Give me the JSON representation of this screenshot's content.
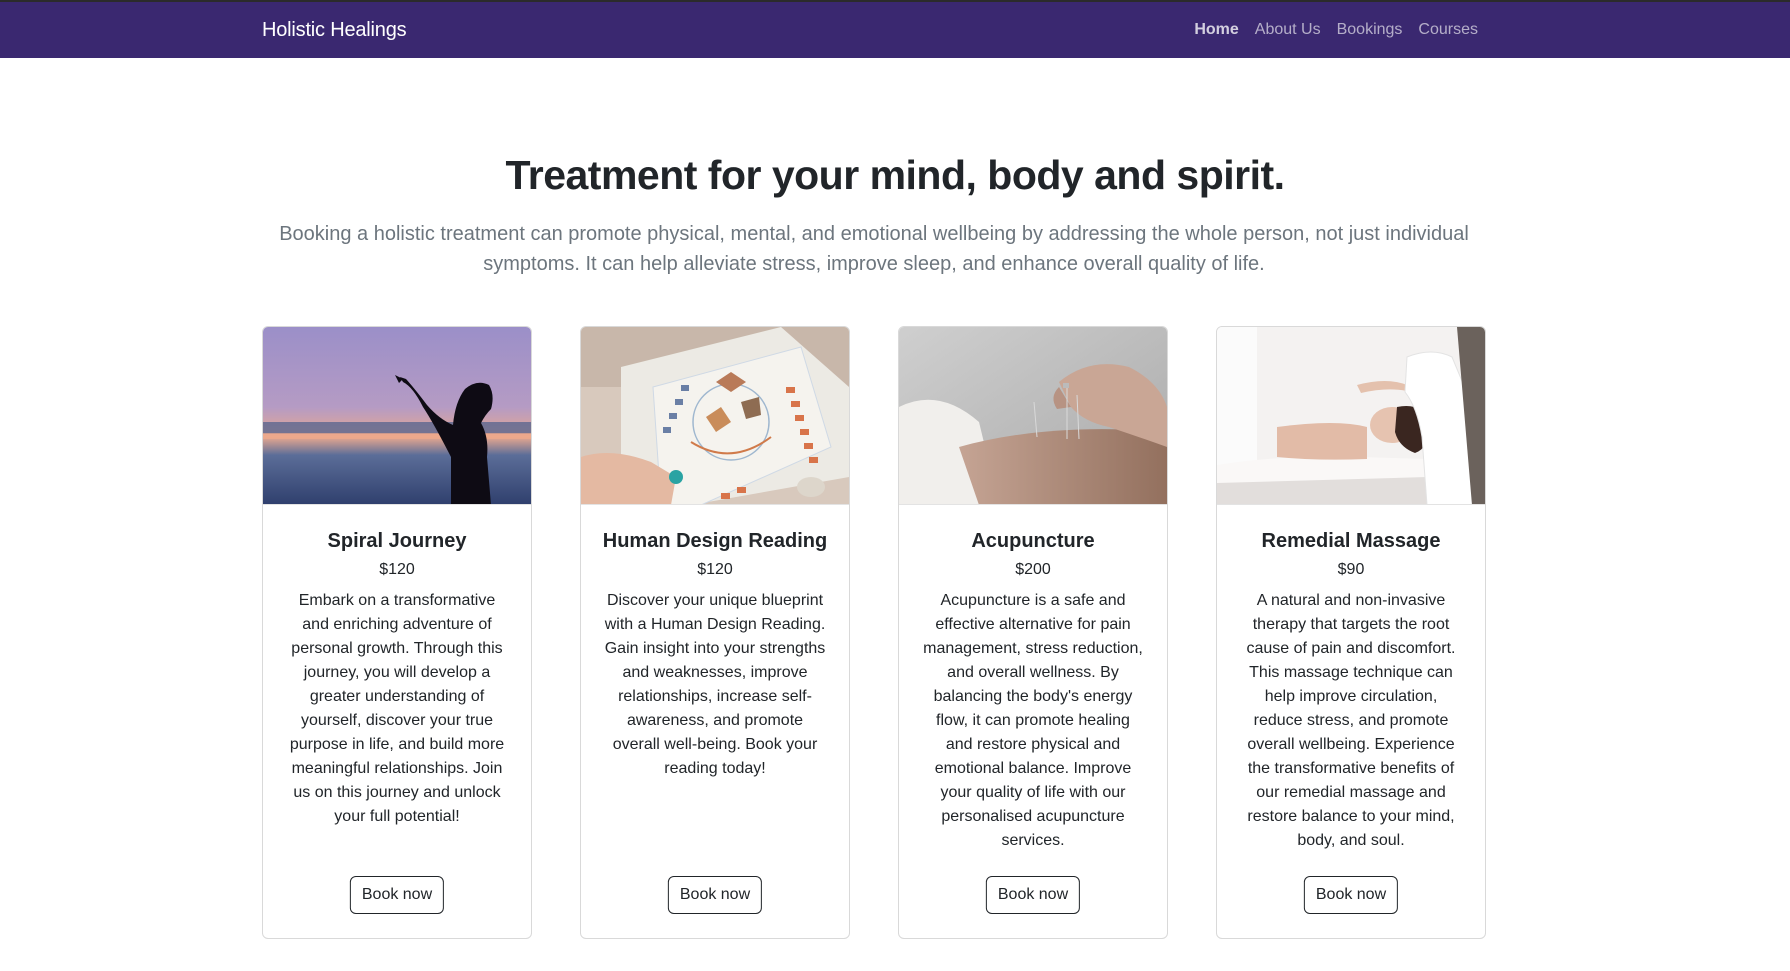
{
  "nav": {
    "brand": "Holistic Healings",
    "links": [
      {
        "label": "Home"
      },
      {
        "label": "About Us"
      },
      {
        "label": "Bookings"
      },
      {
        "label": "Courses"
      }
    ]
  },
  "hero": {
    "title": "Treatment for your mind, body and spirit.",
    "lead": "Booking a holistic treatment can promote physical, mental, and emotional wellbeing by addressing the whole person, not just individual symptoms. It can help alleviate stress, improve sleep, and enhance overall quality of life."
  },
  "cards": [
    {
      "title": "Spiral Journey",
      "price": "$120",
      "text": "Embark on a transformative and enriching adventure of personal growth. Through this journey, you will develop a greater understanding of yourself, discover your true purpose in life, and build more meaningful relationships. Join us on this journey and unlock your full potential!",
      "button": "Book now"
    },
    {
      "title": "Human Design Reading",
      "price": "$120",
      "text": "Discover your unique blueprint with a Human Design Reading. Gain insight into your strengths and weaknesses, improve relationships, increase self-awareness, and promote overall well-being. Book your reading today!",
      "button": "Book now"
    },
    {
      "title": "Acupuncture",
      "price": "$200",
      "text": "Acupuncture is a safe and effective alternative for pain management, stress reduction, and overall wellness. By balancing the body's energy flow, it can promote healing and restore physical and emotional balance. Improve your quality of life with our personalised acupuncture services.",
      "button": "Book now"
    },
    {
      "title": "Remedial Massage",
      "price": "$90",
      "text": "A natural and non-invasive therapy that targets the root cause of pain and discomfort. This massage technique can help improve circulation, reduce stress, and promote overall wellbeing. Experience the transformative benefits of our remedial massage and restore balance to your mind, body, and soul.",
      "button": "Book now"
    }
  ],
  "colors": {
    "navbar": "#3a2870",
    "lead_text": "#6c757d",
    "body_text": "#212529"
  }
}
